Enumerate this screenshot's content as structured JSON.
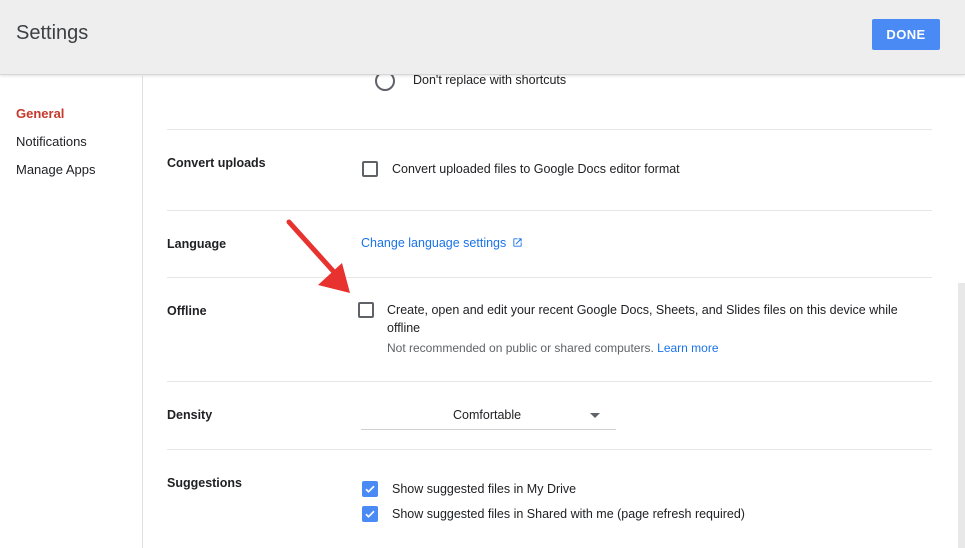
{
  "header": {
    "title": "Settings",
    "done_label": "DONE"
  },
  "sidebar": {
    "items": [
      {
        "label": "General",
        "active": true
      },
      {
        "label": "Notifications",
        "active": false
      },
      {
        "label": "Manage Apps",
        "active": false
      }
    ]
  },
  "settings": {
    "shortcuts": {
      "option_label": "Don't replace with shortcuts",
      "selected": false
    },
    "convert_uploads": {
      "label": "Convert uploads",
      "checkbox_label": "Convert uploaded files to Google Docs editor format",
      "checked": false
    },
    "language": {
      "label": "Language",
      "link_label": "Change language settings"
    },
    "offline": {
      "label": "Offline",
      "checkbox_label_line1": "Create, open and edit your recent Google Docs, Sheets, and Slides files on this device while",
      "checkbox_label_line2": "offline",
      "note": "Not recommended on public or shared computers.",
      "learn_more": "Learn more",
      "checked": false
    },
    "density": {
      "label": "Density",
      "selected": "Comfortable"
    },
    "suggestions": {
      "label": "Suggestions",
      "items": [
        {
          "label": "Show suggested files in My Drive",
          "checked": true
        },
        {
          "label": "Show suggested files in Shared with me (page refresh required)",
          "checked": true
        }
      ]
    }
  },
  "colors": {
    "accent": "#4a8af4",
    "active_nav": "#c5392c",
    "link": "#1a73e8",
    "annotation_arrow": "#e8322f"
  }
}
